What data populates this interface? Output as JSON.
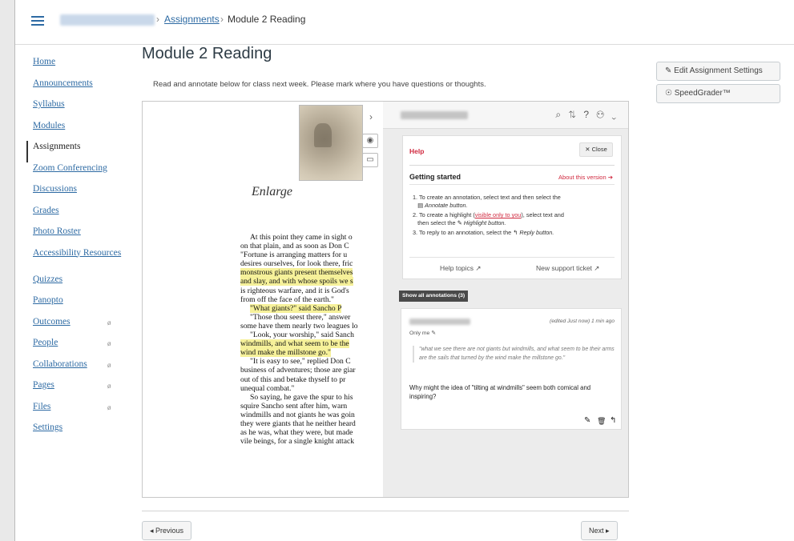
{
  "breadcrumb": {
    "assignments": "Assignments",
    "current": "Module 2 Reading",
    "sep": "›"
  },
  "nav": {
    "items": [
      {
        "label": "Home"
      },
      {
        "label": "Announcements"
      },
      {
        "label": "Syllabus"
      },
      {
        "label": "Modules"
      },
      {
        "label": "Assignments"
      },
      {
        "label": "Zoom Conferencing"
      },
      {
        "label": "Discussions"
      },
      {
        "label": "Grades"
      },
      {
        "label": "Photo Roster"
      },
      {
        "label": "Accessibility Resources"
      },
      {
        "label": "Quizzes"
      },
      {
        "label": "Panopto"
      },
      {
        "label": "Outcomes"
      },
      {
        "label": "People"
      },
      {
        "label": "Collaborations"
      },
      {
        "label": "Pages"
      },
      {
        "label": "Files"
      },
      {
        "label": "Settings"
      }
    ],
    "active": "Assignments",
    "hidden_icon": "eye-slash-icon"
  },
  "page": {
    "title": "Module 2 Reading",
    "instructions": "Read and annotate below for class next week. Please mark where you have questions or thoughts."
  },
  "document": {
    "caption": "Enlarge",
    "lines": [
      {
        "text": "At this point they came in sight o",
        "hl": false,
        "indent": true
      },
      {
        "text": "on that plain, and as soon as Don C",
        "hl": false,
        "indent": false
      },
      {
        "text": "\"Fortune is arranging matters for u",
        "hl": false,
        "indent": false
      },
      {
        "text": "desires ourselves, for look there, fric",
        "hl": false,
        "indent": false
      },
      {
        "text": "monstrous giants present themselves",
        "hl": true,
        "indent": false
      },
      {
        "text": "and slay, and with whose spoils we s",
        "hl": true,
        "indent": false
      },
      {
        "text": "is righteous warfare, and it is God's",
        "hl": false,
        "indent": false
      },
      {
        "text": "from off the face of the earth.\"",
        "hl": false,
        "indent": false
      },
      {
        "text": "\"What giants?\" said Sancho P",
        "hl": true,
        "indent": true
      },
      {
        "text": "\"Those thou seest there,\" answer",
        "hl": false,
        "indent": true
      },
      {
        "text": "some have them nearly two leagues lo",
        "hl": false,
        "indent": false
      },
      {
        "text": "\"Look, your worship,\" said Sanch",
        "hl": false,
        "indent": true
      },
      {
        "text": "windmills, and what seem to be the",
        "hl": true,
        "indent": false
      },
      {
        "text": "wind make the millstone go.\"",
        "hl": true,
        "indent": false
      },
      {
        "text": "\"It is easy to see,\" replied Don C",
        "hl": false,
        "indent": true
      },
      {
        "text": "business of adventures; those are giar",
        "hl": false,
        "indent": false
      },
      {
        "text": "out of this and betake thyself to pr",
        "hl": false,
        "indent": false
      },
      {
        "text": "unequal combat.\"",
        "hl": false,
        "indent": false
      },
      {
        "text": "So saying, he gave the spur to his",
        "hl": false,
        "indent": true
      },
      {
        "text": "squire Sancho sent after him, warn",
        "hl": false,
        "indent": false
      },
      {
        "text": "windmills and not giants he was goin",
        "hl": false,
        "indent": false
      },
      {
        "text": "they were giants that he neither heard",
        "hl": false,
        "indent": false
      },
      {
        "text": "as he was, what they were, but made",
        "hl": false,
        "indent": false
      },
      {
        "text": "vile beings, for a single knight attack",
        "hl": false,
        "indent": false
      }
    ]
  },
  "sidebar": {
    "toggle": "›",
    "tools": {
      "eye": "◉",
      "note": "▭"
    },
    "top_icons": "⌕ ⇅ ? ⚇ ⌄",
    "help": {
      "title": "Help",
      "close_label": "✕ Close",
      "getting_started": "Getting started",
      "about": "About this version ➔",
      "steps": {
        "s1": "1. To create an annotation, select text and then select the",
        "s1b": "Annotate button.",
        "s2a": "2. To create a highlight (",
        "s2link": "visible only to you",
        "s2b": "), select text and",
        "s2c": "then select the",
        "s2d": "Highlight button.",
        "s3a": "3. To reply to an annotation, select the",
        "s3b": "Reply button."
      },
      "topics": "Help topics ↗",
      "ticket": "New support ticket ↗"
    },
    "show_all": "Show all annotations (3)",
    "annotation": {
      "time": "(edited Just now) 1 min ago",
      "visibility": "Only me",
      "quote": "\"what we see there are not giants but windmills, and what seem to be their arms are the sails that turned by the wind make the millstone go.\"",
      "body": "Why might the idea of \"tilting at windmills\" seem both comical and inspiring?",
      "tools": {
        "edit": "✎",
        "delete": "🗑",
        "reply": "↰"
      }
    }
  },
  "right_buttons": {
    "edit": "✎ Edit Assignment Settings",
    "speedgrader": "☉ SpeedGrader™"
  },
  "footer": {
    "prev": "◂ Previous",
    "next": "Next ▸"
  }
}
